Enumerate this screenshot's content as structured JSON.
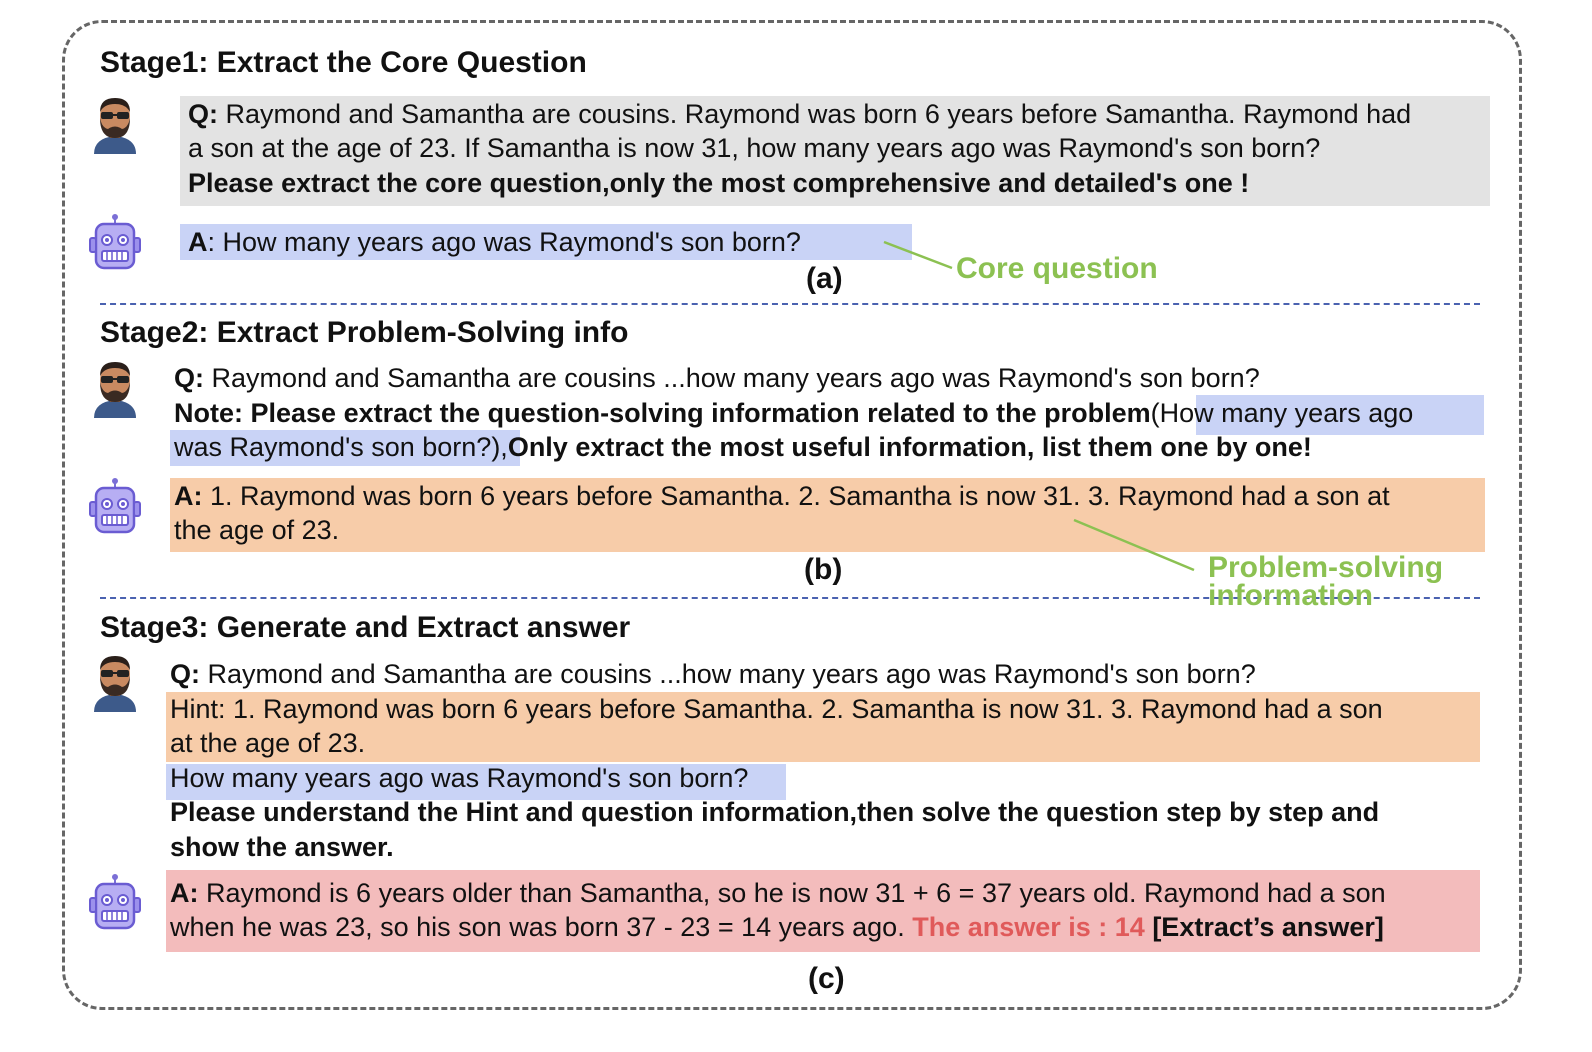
{
  "stage1": {
    "title": "Stage1: Extract the Core Question",
    "q_label": "Q:",
    "q_line1": " Raymond and Samantha are cousins. Raymond was born 6 years before Samantha. Raymond had",
    "q_line2": "a son at the age of 23. If Samantha is now 31, how many years ago was Raymond's son born?",
    "q_line3": "Please extract the core question,only the most comprehensive and detailed's one !",
    "a_label": "A",
    "a_text": ": How many years ago was Raymond's son born?",
    "caption": "(a)",
    "annotation": "Core question"
  },
  "stage2": {
    "title": "Stage2: Extract Problem-Solving info",
    "q_label": "Q:",
    "q_text": " Raymond and Samantha are cousins ...how many years ago was  Raymond's son born?",
    "note_bold": "Note: Please extract the question-solving information related to the problem",
    "note_hl1": "(How many years ago",
    "note_hl2": "was Raymond's son born?),",
    "note_bold2": "Only extract the most useful information, list them one by one!",
    "a_label": "A:",
    "a_line1": "  1. Raymond was born 6 years before Samantha. 2. Samantha is now 31. 3. Raymond had a son at",
    "a_line2": "the age of  23.",
    "caption": "(b)",
    "annotation_line1": "Problem-solving",
    "annotation_line2": "information"
  },
  "stage3": {
    "title": "Stage3: Generate and Extract answer",
    "q_label": "Q:",
    "q_text": " Raymond and Samantha are cousins ...how many years ago was Raymond's son born?",
    "hint_line1": "Hint: 1. Raymond was born 6 years before Samantha. 2. Samantha is now 31.  3.  Raymond had a son",
    "hint_line2": "at the age of 23.",
    "core_q": "How many years ago was Raymond's son born?",
    "instr_line1": "Please understand the Hint and question information,then solve the question step by step and",
    "instr_line2": "show the answer.",
    "a_label": "A:",
    "a_line1": " Raymond is 6 years older than Samantha, so he is now 31 + 6 = 37 years old. Raymond had a son",
    "a_line2": "when he was 23, so his son was born 37 - 23 = 14 years ago. ",
    "answer_text": "The answer is : 14",
    "extract_tag": " [Extract’s answer]",
    "caption": "(c)"
  },
  "icons": {
    "human": "bearded-man-avatar-icon",
    "robot": "robot-assistant-icon"
  },
  "colors": {
    "question_bg": "#e3e3e3",
    "core_question_bg": "#c9d3f6",
    "info_bg": "#f7cca9",
    "answer_bg": "#f3bcbc",
    "annotation": "#8cc152",
    "answer_text": "#e05a5a"
  }
}
